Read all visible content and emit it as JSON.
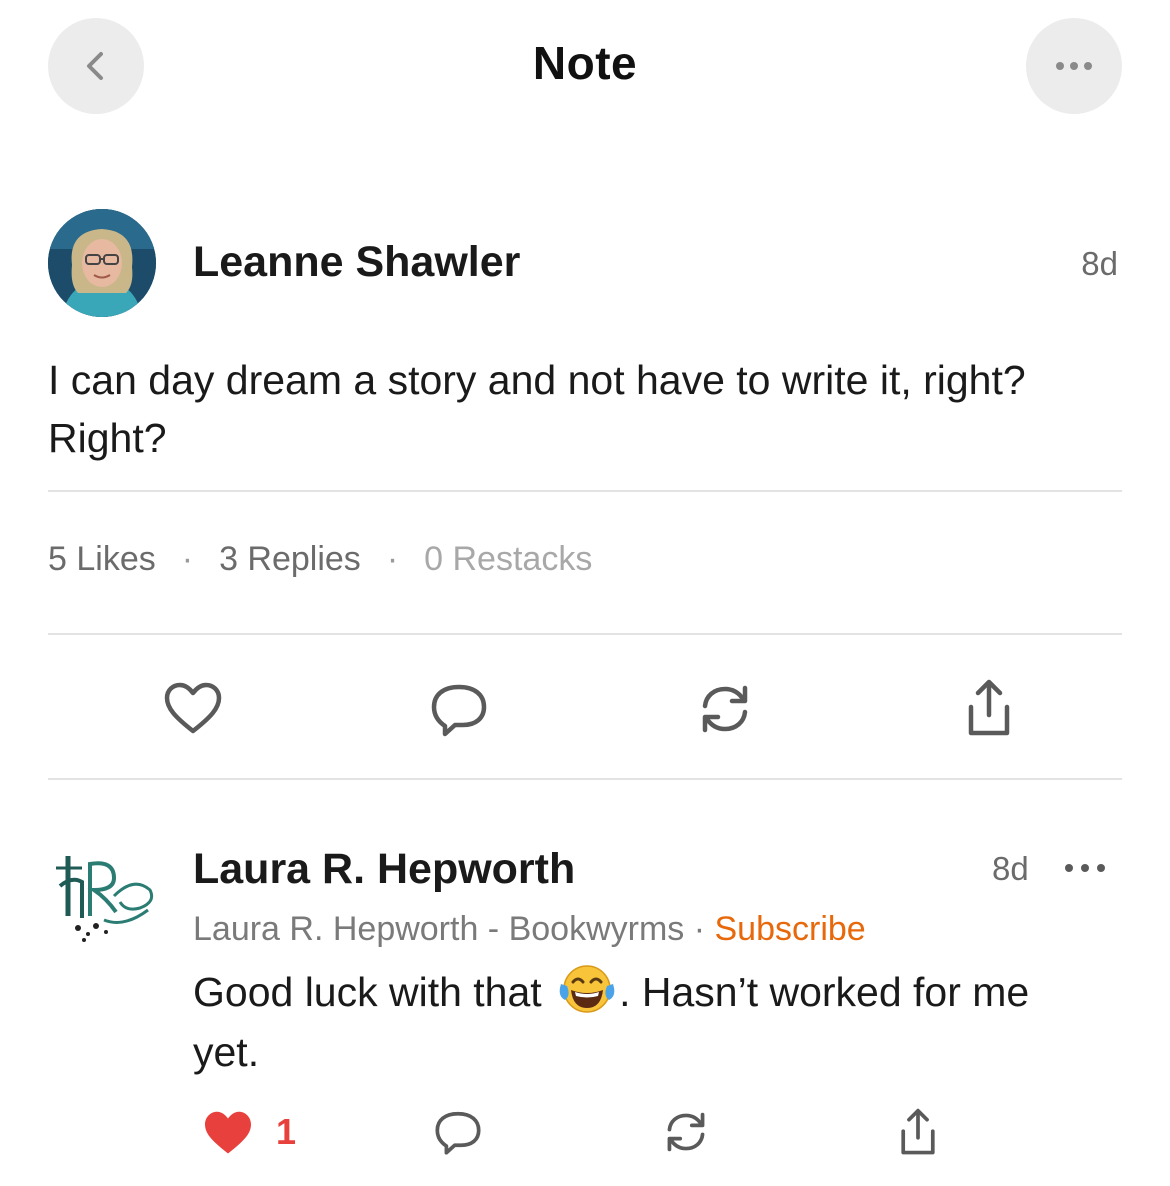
{
  "header": {
    "title": "Note",
    "back_icon": "chevron-left-icon",
    "more_icon": "ellipsis-icon"
  },
  "post": {
    "author": "Leanne Shawler",
    "time": "8d",
    "body": "I can day dream a story and not have to write it, right? Right?",
    "stats": {
      "likes": "5 Likes",
      "replies": "3 Replies",
      "restacks": "0 Restacks",
      "separator": "·"
    },
    "actions": [
      "heart-icon",
      "comment-icon",
      "restack-icon",
      "share-icon"
    ]
  },
  "reply": {
    "author": "Laura R. Hepworth",
    "time": "8d",
    "publication": "Laura R. Hepworth - Bookwyrms",
    "separator": " · ",
    "subscribe_label": "Subscribe",
    "body_before_emoji": "Good luck with that",
    "body_after_emoji": ". Hasn’t worked for me yet.",
    "like_count": "1",
    "liked": true
  },
  "colors": {
    "accent": "#e8690c",
    "liked": "#e8403c",
    "muted_text": "#6b6b6b",
    "button_bg": "#ececec"
  }
}
